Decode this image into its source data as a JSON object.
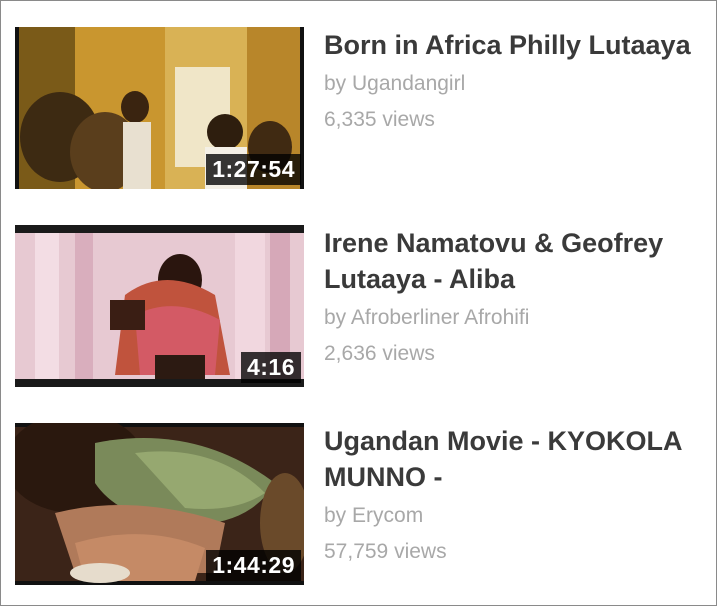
{
  "videos": [
    {
      "title": "Born in Africa Philly Lutaaya",
      "author": "by Ugandangirl",
      "views": "6,335 views",
      "duration": "1:27:54"
    },
    {
      "title": "Irene Namatovu & Geofrey Lutaaya - Aliba",
      "author": "by Afroberliner Afrohifi",
      "views": "2,636 views",
      "duration": "4:16"
    },
    {
      "title": "Ugandan Movie - KYOKOLA MUNNO -",
      "author": "by Erycom",
      "views": "57,759 views",
      "duration": "1:44:29"
    }
  ],
  "colors": {
    "title": "#3a3a3a",
    "meta": "#a8a8a8",
    "duration_bg": "#000000",
    "duration_text": "#ffffff",
    "border": "#8a8a8a"
  }
}
